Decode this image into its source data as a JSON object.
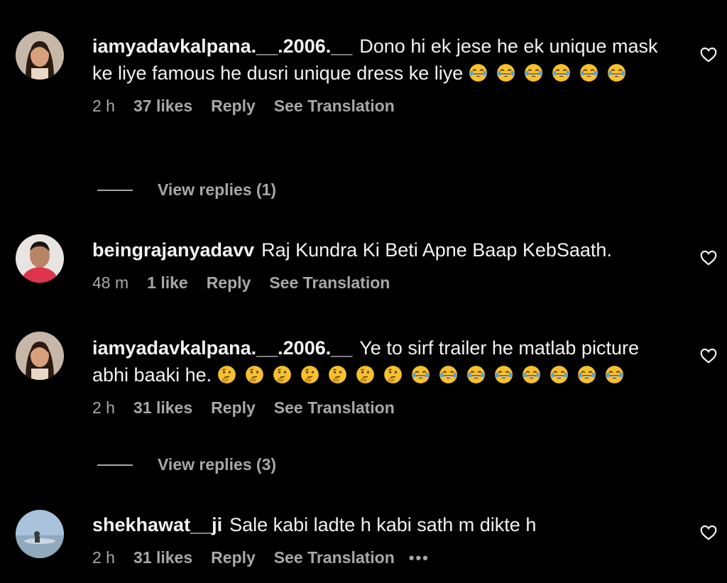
{
  "comments": [
    {
      "username": "iamyadavkalpana.__.2006.__",
      "text": "Dono hi ek jese he ek unique mask ke liye famous he dusri unique dress ke liye",
      "emojis": [
        "face-with-tears-of-joy",
        "face-with-tears-of-joy",
        "face-with-tears-of-joy",
        "face-with-tears-of-joy",
        "face-with-tears-of-joy",
        "face-with-tears-of-joy"
      ],
      "time": "2 h",
      "likes": "37 likes",
      "reply": "Reply",
      "translation": "See Translation",
      "view_replies": "View replies (1)"
    },
    {
      "username": "beingrajanyadavv",
      "text": "Raj Kundra Ki Beti Apne Baap KebSaath.",
      "time": "48 m",
      "likes": "1 like",
      "reply": "Reply",
      "translation": "See Translation"
    },
    {
      "username": "iamyadavkalpana.__.2006.__",
      "text": "Ye to sirf trailer he matlab picture abhi baaki he.",
      "emojis": [
        "thinking-face",
        "thinking-face",
        "thinking-face",
        "thinking-face",
        "thinking-face",
        "thinking-face",
        "thinking-face",
        "face-with-tears-of-joy",
        "face-with-tears-of-joy",
        "face-with-tears-of-joy",
        "face-with-tears-of-joy",
        "face-with-tears-of-joy",
        "face-with-tears-of-joy",
        "face-with-tears-of-joy",
        "face-with-tears-of-joy"
      ],
      "time": "2 h",
      "likes": "31 likes",
      "reply": "Reply",
      "translation": "See Translation",
      "view_replies": "View replies (3)"
    },
    {
      "username": "shekhawat__ji",
      "text": "Sale kabi ladte h kabi sath m dikte h",
      "time": "2 h",
      "likes": "31 likes",
      "reply": "Reply",
      "translation": "See Translation",
      "more": "•••"
    }
  ],
  "colors": {
    "background": "#000000",
    "text": "#f2f2f2",
    "muted": "#a8a8a8",
    "emoji_yellow": "#f7c02f"
  },
  "icons": {
    "like": "heart-outline-icon",
    "more": "more-options-icon"
  }
}
